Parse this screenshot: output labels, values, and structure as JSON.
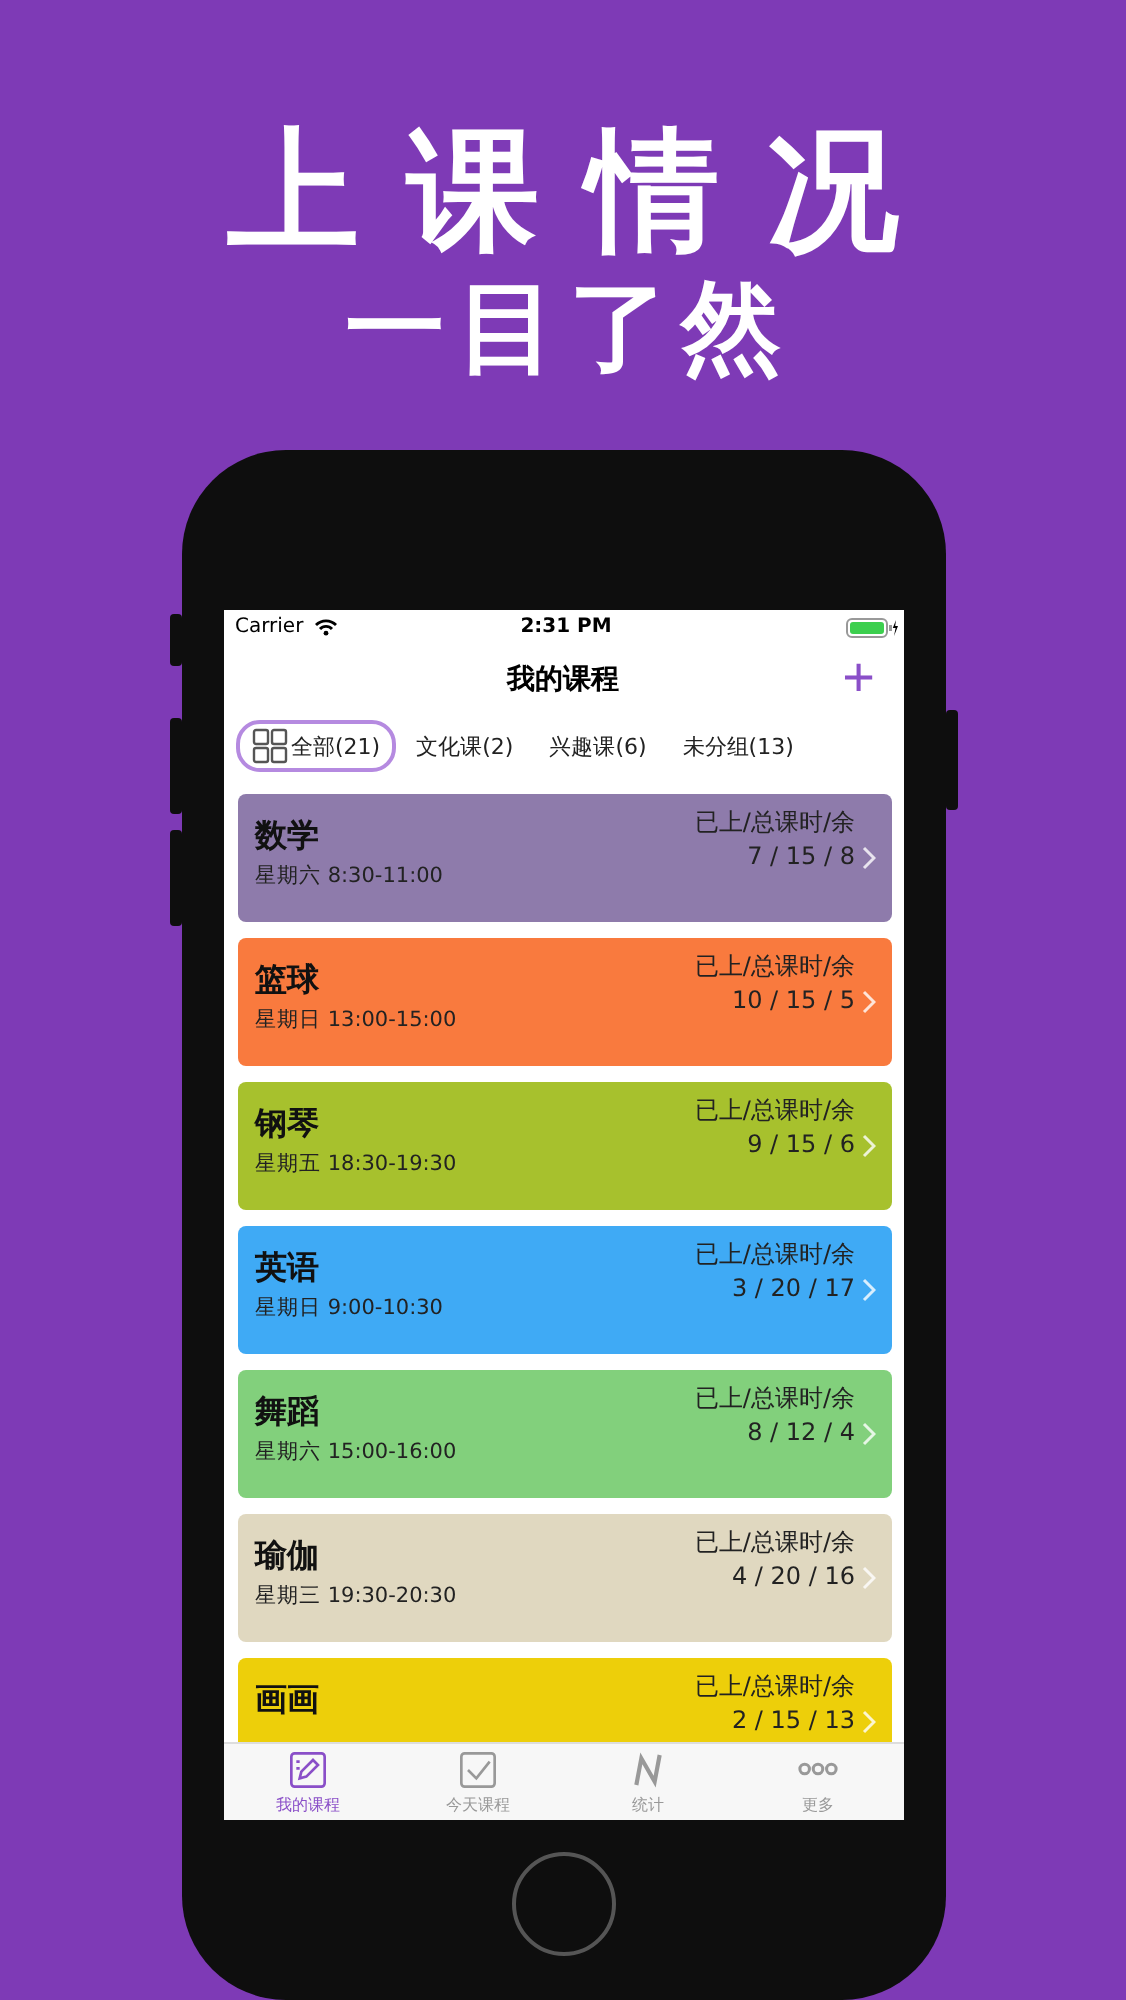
{
  "headline": "上课情况",
  "subheadline": "一目了然",
  "status_bar": {
    "carrier": "Carrier",
    "time": "2:31 PM"
  },
  "nav": {
    "title": "我的课程",
    "add": "+"
  },
  "filters": [
    {
      "label": "全部(21)",
      "selected": true
    },
    {
      "label": "文化课(2)",
      "selected": false
    },
    {
      "label": "兴趣课(6)",
      "selected": false
    },
    {
      "label": "未分组(13)",
      "selected": false
    }
  ],
  "courses": [
    {
      "name": "数学",
      "schedule": "星期六  8:30-11:00",
      "stats_label": "已上/总课时/余",
      "stats": "7 / 15 / 8",
      "color": "#8e7bab"
    },
    {
      "name": "篮球",
      "schedule": "星期日  13:00-15:00",
      "stats_label": "已上/总课时/余",
      "stats": "10 / 15 / 5",
      "color": "#f97a3e"
    },
    {
      "name": "钢琴",
      "schedule": "星期五  18:30-19:30",
      "stats_label": "已上/总课时/余",
      "stats": "9 / 15 / 6",
      "color": "#a7c12d"
    },
    {
      "name": "英语",
      "schedule": "星期日  9:00-10:30",
      "stats_label": "已上/总课时/余",
      "stats": "3 / 20 / 17",
      "color": "#3faaf5"
    },
    {
      "name": "舞蹈",
      "schedule": "星期六  15:00-16:00",
      "stats_label": "已上/总课时/余",
      "stats": "8 / 12 / 4",
      "color": "#82d07c"
    },
    {
      "name": "瑜伽",
      "schedule": "星期三  19:30-20:30",
      "stats_label": "已上/总课时/余",
      "stats": "4 / 20 / 16",
      "color": "#e0d8c0"
    },
    {
      "name": "画画",
      "stats_label": "已上/总课时/余",
      "stats": "2 / 15 / 13",
      "color": "#edcf0a"
    }
  ],
  "tab_bar": [
    {
      "kind": "edit",
      "label": "我的课程",
      "selected": true
    },
    {
      "kind": "check",
      "label": "今天课程",
      "selected": false
    },
    {
      "kind": "stats",
      "label": "统计",
      "selected": false
    },
    {
      "kind": "more",
      "label": "更多",
      "selected": false
    }
  ]
}
